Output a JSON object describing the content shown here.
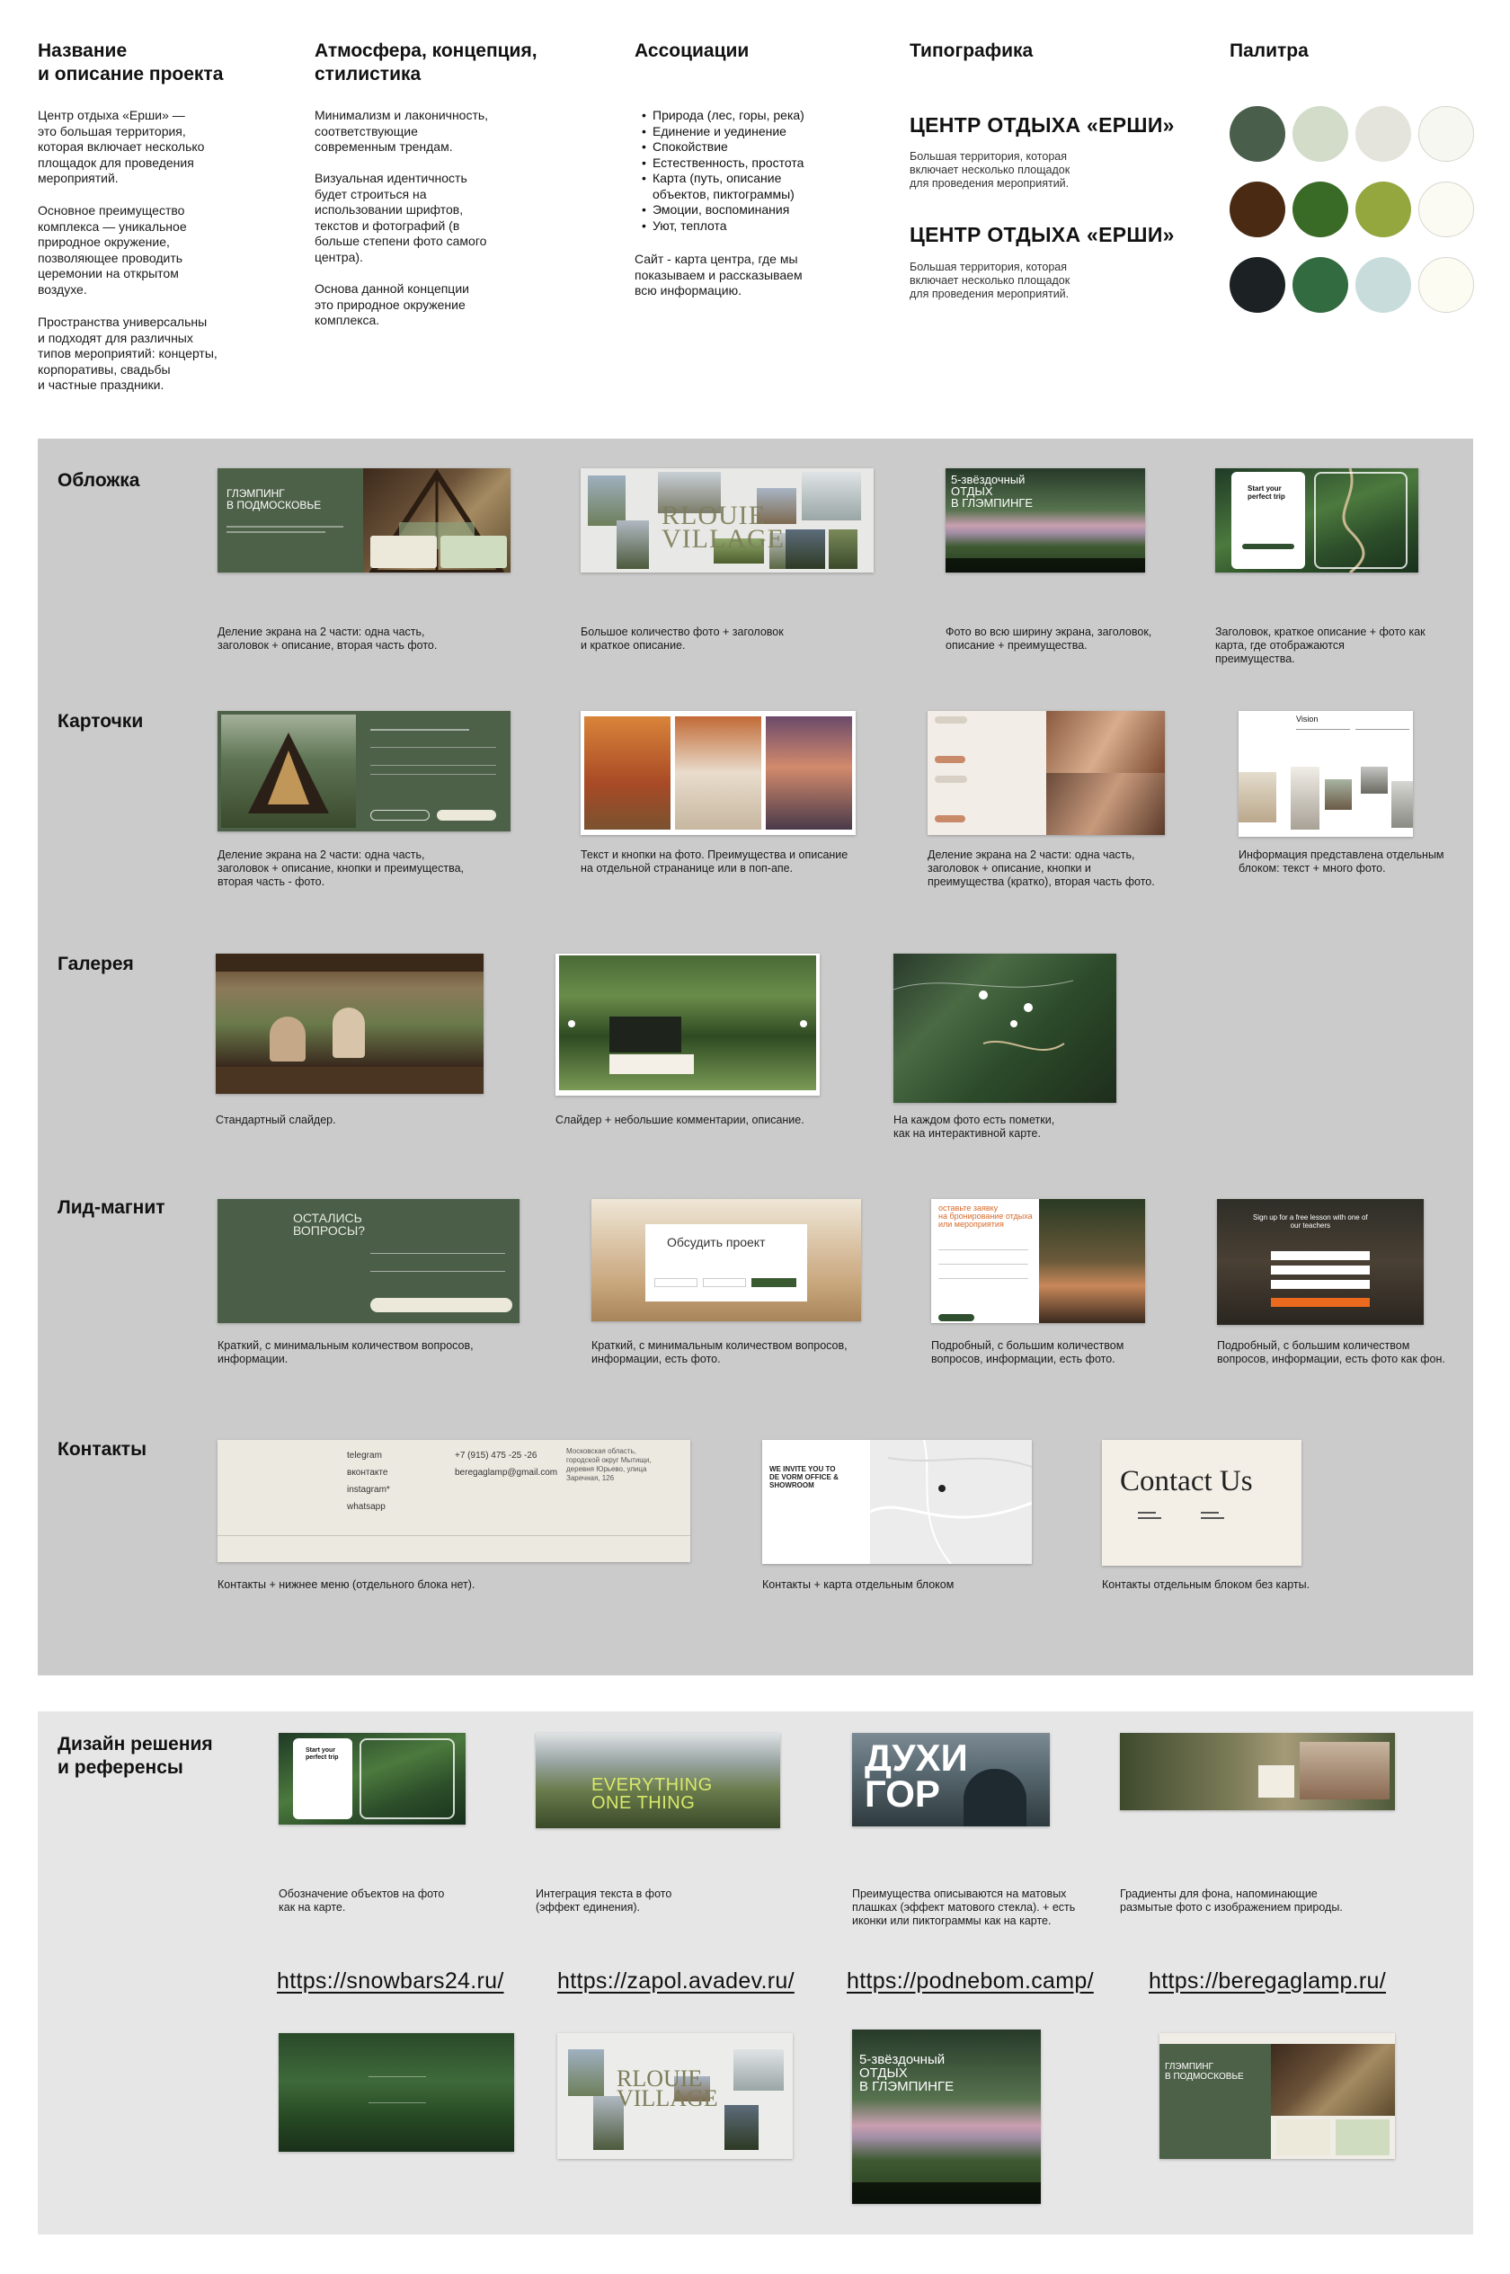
{
  "top": {
    "col1": {
      "title": "Название\nи описание проекта",
      "p1": "Центр отдыха «Ерши» —\nэто большая территория,\nкоторая включает несколько\nплощадок для проведения\nмероприятий.",
      "p2": "Основное преимущество\nкомплекса — уникальное\nприродное окружение,\nпозволяющее проводить\nцеремонии на открытом\nвоздухе.",
      "p3": "Пространства универсальны\nи подходят для различных\nтипов мероприятий: концерты,\nкорпоративы, свадьбы\nи частные праздники."
    },
    "col2": {
      "title": "Атмосфера, концепция,\nстилистика",
      "p1": "Минимализм и лаконичность,\nсоответствующие\nсовременным трендам.",
      "p2": "Визуальная идентичность\nбудет строиться на\nиспользовании шрифтов,\nтекстов и фотографий  (в\nбольше степени фото самого\nцентра).",
      "p3": "Основа данной концепции\nэто природное окружение\nкомплекса."
    },
    "col3": {
      "title": "Ассоциации",
      "items": [
        "Природа (лес, горы, река)",
        "Единение и уединение",
        "Спокойствие",
        "Естественность, простота",
        "Карта (путь, описание\nобъектов, пиктограммы)",
        "Эмоции, воспоминания",
        "Уют, теплота"
      ],
      "note": "Сайт - карта центра, где мы\nпоказываем и рассказываем\nвсю информацию."
    },
    "col4": {
      "title": "Типографика",
      "heading1": "ЦЕНТР ОТДЫХА «ЕРШИ»",
      "sub1": "Большая территория, которая\nвключает несколько площадок\nдля проведения мероприятий.",
      "heading2": "ЦЕНТР ОТДЫХА «ЕРШИ»",
      "sub2": "Большая территория, которая\nвключает несколько площадок\nдля проведения мероприятий."
    },
    "col5": {
      "title": "Палитра",
      "colors": [
        [
          "#4a5e4c",
          "#d2dcc9",
          "#e4e4dc",
          "#f7f7f2"
        ],
        [
          "#4a2a12",
          "#3a6b26",
          "#94a63e",
          "#fbfbf4"
        ],
        [
          "#1c2124",
          "#336b40",
          "#c9dcdc",
          "#fcfcf2"
        ]
      ]
    }
  },
  "sections": {
    "cover": {
      "title": "Обложка",
      "thumb1_title": "ГЛЭМПИНГ\nВ ПОДМОСКОВЬЕ",
      "thumb2_title": "RLOUIE\nVILLAGE",
      "thumb3_title": "5-звёздочный\nОТДЫХ\nВ ГЛЭМПИНГЕ",
      "thumb4_title": "Start your\nperfect trip",
      "captions": [
        "Деление экрана на 2 части: одна часть,\nзаголовок + описание, вторая часть фото.",
        "Большое количество фото + заголовок\nи краткое описание.",
        "Фото во всю ширину экрана, заголовок,\nописание + преимущества.",
        "Заголовок, краткое описание + фото как\nкарта, где отображаются\nпреимущества."
      ]
    },
    "cards": {
      "title": "Карточки",
      "thumb4_title": "Vision",
      "captions": [
        "Деление экрана на 2 части: одна часть,\nзаголовок + описание, кнопки и преимущества,\nвторая часть -  фото.",
        "Текст и кнопки на фото. Преимущества и описание\nна отдельной странаницe или в поп-апе.",
        "Деление экрана на 2 части: одна часть,\nзаголовок + описание, кнопки и\nпреимущества (кратко), вторая часть фото.",
        "Информация представлена отдельным\nблоком: текст + много фото."
      ]
    },
    "gallery": {
      "title": "Галерея",
      "captions": [
        "Стандартный слайдер.",
        "Слайдер + небольшие комментарии, описание.",
        "На каждом фото есть пометки,\nкак на интерактивной карте."
      ]
    },
    "lead": {
      "title": "Лид-магнит",
      "thumb1_title": "ОСТАЛИСЬ\nВОПРОСЫ?",
      "thumb2_title": "Обсудить проект",
      "thumb3_title": "оставьте заявку\nна бронирование отдыха\nили мероприятия",
      "thumb4_title": "Sign up for a free lesson with one of\nour teachers",
      "captions": [
        "Краткий, с минимальным количеством вопросов,\nинформации.",
        "Краткий, с минимальным количеством вопросов,\nинформации, есть фото.",
        "Подробный, с большим количеством\nвопросов, информации, есть фото.",
        "Подробный, с большим количеством\nвопросов, информации, есть фото как фон."
      ]
    },
    "contacts": {
      "title": "Контакты",
      "links": [
        "telegram",
        "вконтакте",
        "instagram*",
        "whatsapp"
      ],
      "phone": "+7 (915) 475 -25 -26",
      "email": "beregaglamp@gmail.com",
      "address": "Московская область,\nгородской округ Мытищи,\nдеревня Юрьево, улица\nЗаречная, 126",
      "invite": "WE INVITE YOU TO\nDE VORM OFFICE &\nSHOWROOM",
      "contact_us": "Contact Us",
      "captions": [
        "Контакты + нижнее меню (отдельного блока нет).",
        "Контакты + карта отдельным блоком",
        "Контакты отдельным блоком без карты."
      ]
    }
  },
  "design": {
    "title": "Дизайн решения\nи референсы",
    "thumb1_title": "Start your\nperfect trip",
    "thumb2_title": "EVERYTHING\nONE THING",
    "thumb3_title": "ДУХИ\nГОР",
    "captions": [
      "Обозначение объектов на фото\nкак на карте.",
      "Интеграция текста в фото\n(эффект единения).",
      "Преимущества описываются на матовых\nплашках (эффект матового стекла). + есть\nиконки или пиктограммы как на карте.",
      "Градиенты для фона, напоминающие\nразмытые фото с изображением природы."
    ],
    "links": [
      "https://snowbars24.ru/",
      "https://zapol.avadev.ru/",
      "https://podnebom.camp/",
      "https://beregaglamp.ru/"
    ],
    "ref2_title": "RLOUIE\nVILLAGE",
    "ref3_title": "5-звёздочный\nОТДЫХ\nВ ГЛЭМПИНГЕ",
    "ref4_title": "ГЛЭМПИНГ\nВ ПОДМОСКОВЬЕ"
  }
}
